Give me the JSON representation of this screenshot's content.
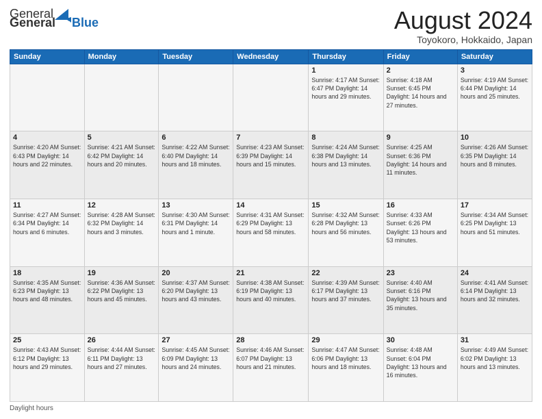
{
  "logo": {
    "general": "General",
    "blue": "Blue"
  },
  "header": {
    "month": "August 2024",
    "location": "Toyokoro, Hokkaido, Japan"
  },
  "weekdays": [
    "Sunday",
    "Monday",
    "Tuesday",
    "Wednesday",
    "Thursday",
    "Friday",
    "Saturday"
  ],
  "weeks": [
    [
      {
        "day": "",
        "info": ""
      },
      {
        "day": "",
        "info": ""
      },
      {
        "day": "",
        "info": ""
      },
      {
        "day": "",
        "info": ""
      },
      {
        "day": "1",
        "info": "Sunrise: 4:17 AM\nSunset: 6:47 PM\nDaylight: 14 hours and 29 minutes."
      },
      {
        "day": "2",
        "info": "Sunrise: 4:18 AM\nSunset: 6:45 PM\nDaylight: 14 hours and 27 minutes."
      },
      {
        "day": "3",
        "info": "Sunrise: 4:19 AM\nSunset: 6:44 PM\nDaylight: 14 hours and 25 minutes."
      }
    ],
    [
      {
        "day": "4",
        "info": "Sunrise: 4:20 AM\nSunset: 6:43 PM\nDaylight: 14 hours and 22 minutes."
      },
      {
        "day": "5",
        "info": "Sunrise: 4:21 AM\nSunset: 6:42 PM\nDaylight: 14 hours and 20 minutes."
      },
      {
        "day": "6",
        "info": "Sunrise: 4:22 AM\nSunset: 6:40 PM\nDaylight: 14 hours and 18 minutes."
      },
      {
        "day": "7",
        "info": "Sunrise: 4:23 AM\nSunset: 6:39 PM\nDaylight: 14 hours and 15 minutes."
      },
      {
        "day": "8",
        "info": "Sunrise: 4:24 AM\nSunset: 6:38 PM\nDaylight: 14 hours and 13 minutes."
      },
      {
        "day": "9",
        "info": "Sunrise: 4:25 AM\nSunset: 6:36 PM\nDaylight: 14 hours and 11 minutes."
      },
      {
        "day": "10",
        "info": "Sunrise: 4:26 AM\nSunset: 6:35 PM\nDaylight: 14 hours and 8 minutes."
      }
    ],
    [
      {
        "day": "11",
        "info": "Sunrise: 4:27 AM\nSunset: 6:34 PM\nDaylight: 14 hours and 6 minutes."
      },
      {
        "day": "12",
        "info": "Sunrise: 4:28 AM\nSunset: 6:32 PM\nDaylight: 14 hours and 3 minutes."
      },
      {
        "day": "13",
        "info": "Sunrise: 4:30 AM\nSunset: 6:31 PM\nDaylight: 14 hours and 1 minute."
      },
      {
        "day": "14",
        "info": "Sunrise: 4:31 AM\nSunset: 6:29 PM\nDaylight: 13 hours and 58 minutes."
      },
      {
        "day": "15",
        "info": "Sunrise: 4:32 AM\nSunset: 6:28 PM\nDaylight: 13 hours and 56 minutes."
      },
      {
        "day": "16",
        "info": "Sunrise: 4:33 AM\nSunset: 6:26 PM\nDaylight: 13 hours and 53 minutes."
      },
      {
        "day": "17",
        "info": "Sunrise: 4:34 AM\nSunset: 6:25 PM\nDaylight: 13 hours and 51 minutes."
      }
    ],
    [
      {
        "day": "18",
        "info": "Sunrise: 4:35 AM\nSunset: 6:23 PM\nDaylight: 13 hours and 48 minutes."
      },
      {
        "day": "19",
        "info": "Sunrise: 4:36 AM\nSunset: 6:22 PM\nDaylight: 13 hours and 45 minutes."
      },
      {
        "day": "20",
        "info": "Sunrise: 4:37 AM\nSunset: 6:20 PM\nDaylight: 13 hours and 43 minutes."
      },
      {
        "day": "21",
        "info": "Sunrise: 4:38 AM\nSunset: 6:19 PM\nDaylight: 13 hours and 40 minutes."
      },
      {
        "day": "22",
        "info": "Sunrise: 4:39 AM\nSunset: 6:17 PM\nDaylight: 13 hours and 37 minutes."
      },
      {
        "day": "23",
        "info": "Sunrise: 4:40 AM\nSunset: 6:16 PM\nDaylight: 13 hours and 35 minutes."
      },
      {
        "day": "24",
        "info": "Sunrise: 4:41 AM\nSunset: 6:14 PM\nDaylight: 13 hours and 32 minutes."
      }
    ],
    [
      {
        "day": "25",
        "info": "Sunrise: 4:43 AM\nSunset: 6:12 PM\nDaylight: 13 hours and 29 minutes."
      },
      {
        "day": "26",
        "info": "Sunrise: 4:44 AM\nSunset: 6:11 PM\nDaylight: 13 hours and 27 minutes."
      },
      {
        "day": "27",
        "info": "Sunrise: 4:45 AM\nSunset: 6:09 PM\nDaylight: 13 hours and 24 minutes."
      },
      {
        "day": "28",
        "info": "Sunrise: 4:46 AM\nSunset: 6:07 PM\nDaylight: 13 hours and 21 minutes."
      },
      {
        "day": "29",
        "info": "Sunrise: 4:47 AM\nSunset: 6:06 PM\nDaylight: 13 hours and 18 minutes."
      },
      {
        "day": "30",
        "info": "Sunrise: 4:48 AM\nSunset: 6:04 PM\nDaylight: 13 hours and 16 minutes."
      },
      {
        "day": "31",
        "info": "Sunrise: 4:49 AM\nSunset: 6:02 PM\nDaylight: 13 hours and 13 minutes."
      }
    ]
  ],
  "footer": {
    "daylight_label": "Daylight hours"
  },
  "colors": {
    "header_bg": "#1a6bb5",
    "accent": "#1a5fa8"
  }
}
